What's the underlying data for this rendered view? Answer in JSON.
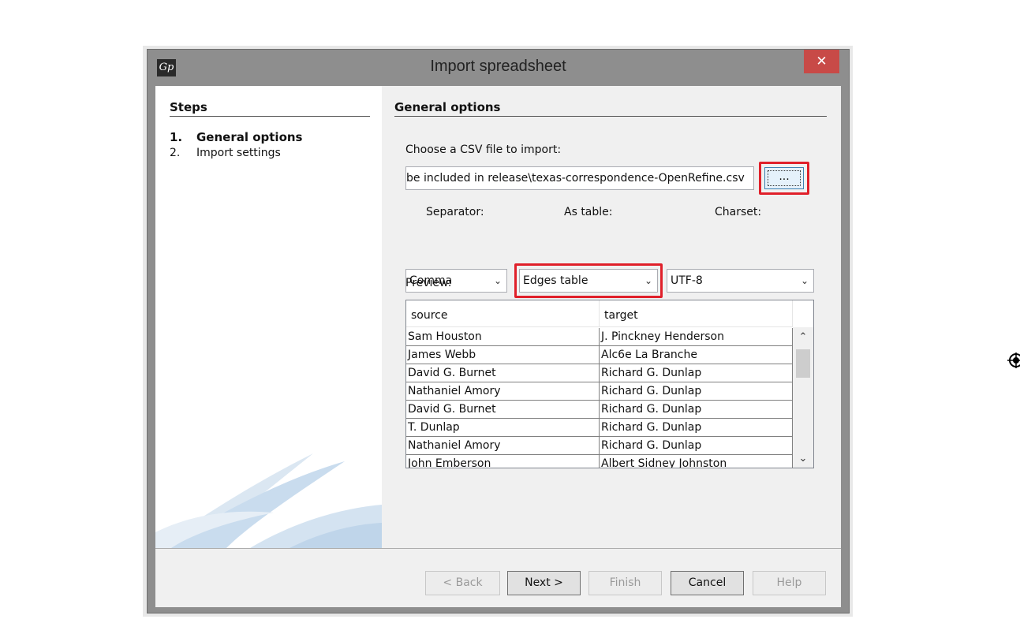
{
  "window": {
    "title": "Import spreadsheet",
    "app_icon_glyph": "Gp",
    "close_glyph": "✕"
  },
  "steps": {
    "title": "Steps",
    "items": [
      {
        "num": "1.",
        "label": "General options",
        "active": true
      },
      {
        "num": "2.",
        "label": "Import settings",
        "active": false
      }
    ]
  },
  "general": {
    "title": "General options",
    "file_label": "Choose a CSV file to import:",
    "file_path": "be included in release\\texas-correspondence-OpenRefine.csv",
    "browse_label": "...",
    "separator_label": "Separator:",
    "as_table_label": "As table:",
    "charset_label": "Charset:",
    "separator_value": "Comma",
    "as_table_value": "Edges table",
    "charset_value": "UTF-8",
    "preview_label": "Preview:"
  },
  "preview": {
    "columns": [
      "source",
      "target"
    ],
    "rows": [
      [
        "Sam Houston",
        "J. Pinckney Henderson"
      ],
      [
        "James Webb",
        "Alc6e La Branche"
      ],
      [
        "David G. Burnet",
        "Richard G. Dunlap"
      ],
      [
        "Nathaniel Amory",
        "Richard G. Dunlap"
      ],
      [
        "David G. Burnet",
        "Richard G. Dunlap"
      ],
      [
        "T. Dunlap",
        "Richard G. Dunlap"
      ],
      [
        "Nathaniel Amory",
        "Richard G. Dunlap"
      ],
      [
        "John Emberson",
        "Albert Sidney Johnston"
      ]
    ],
    "scroll_up_glyph": "^",
    "scroll_down_glyph": "v"
  },
  "buttons": {
    "back": "< Back",
    "next": "Next >",
    "finish": "Finish",
    "cancel": "Cancel",
    "help": "Help"
  },
  "colors": {
    "highlight": "#e0202a",
    "close_button": "#c84a47",
    "window_frame": "#8e8e8e"
  },
  "icons": {
    "side": "crosshair-target-icon"
  }
}
